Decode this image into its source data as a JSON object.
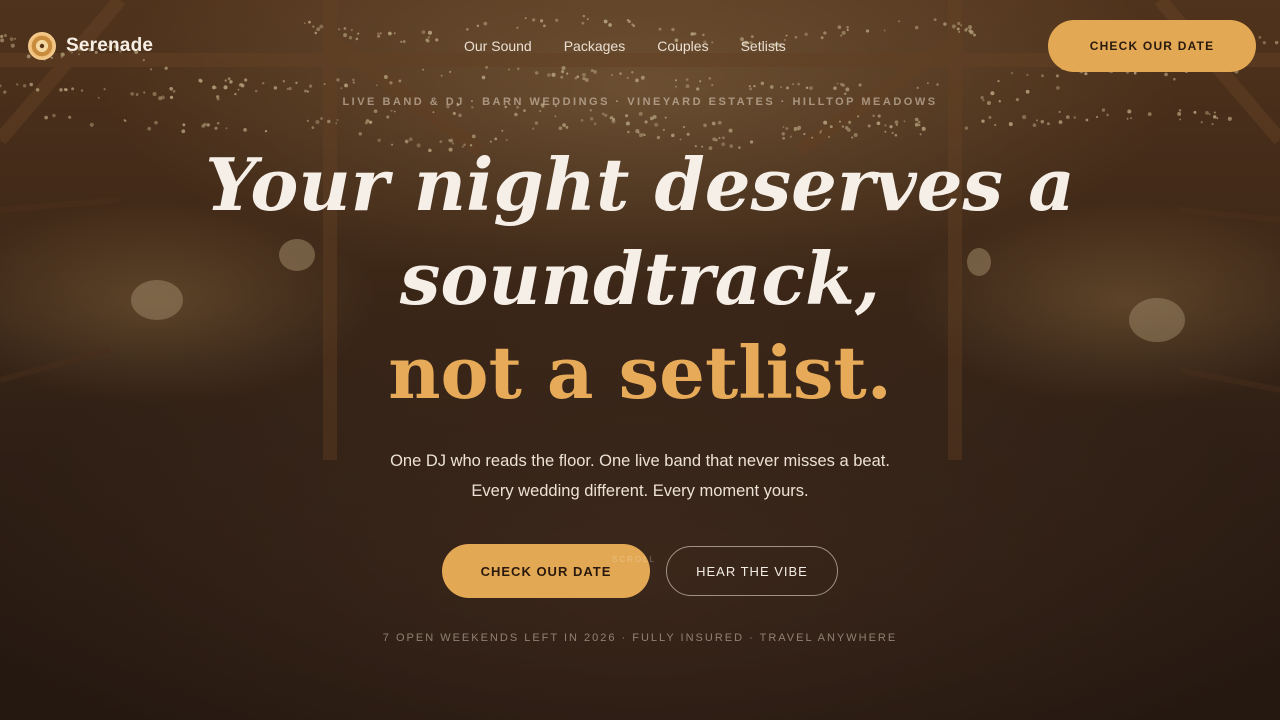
{
  "brand": {
    "name": "Serenade",
    "logo_icon": "vinyl-record-icon"
  },
  "nav": {
    "items": [
      "Our Sound",
      "Packages",
      "Couples",
      "Setlists"
    ],
    "cta": "CHECK OUR DATE"
  },
  "hero": {
    "kicker": "LIVE BAND & DJ · BARN WEDDINGS · VINEYARD ESTATES · HILLTOP MEADOWS",
    "headline_line1": "Your night deserves a",
    "headline_line2": "soundtrack,",
    "headline_accent": "not a setlist.",
    "subtitle": "One DJ who reads the floor. One live band that never misses a beat. Every wedding different. Every moment yours.",
    "primary_cta": "CHECK OUR DATE",
    "secondary_cta": "HEAR THE VIBE",
    "scroll_hint": "SCROLL",
    "trust_line": "7 OPEN WEEKENDS LEFT IN 2026 · FULLY INSURED · TRAVEL ANYWHERE"
  },
  "colors": {
    "accent": "#e3a854",
    "background": "#2a1b12",
    "text": "#f6efe8"
  }
}
